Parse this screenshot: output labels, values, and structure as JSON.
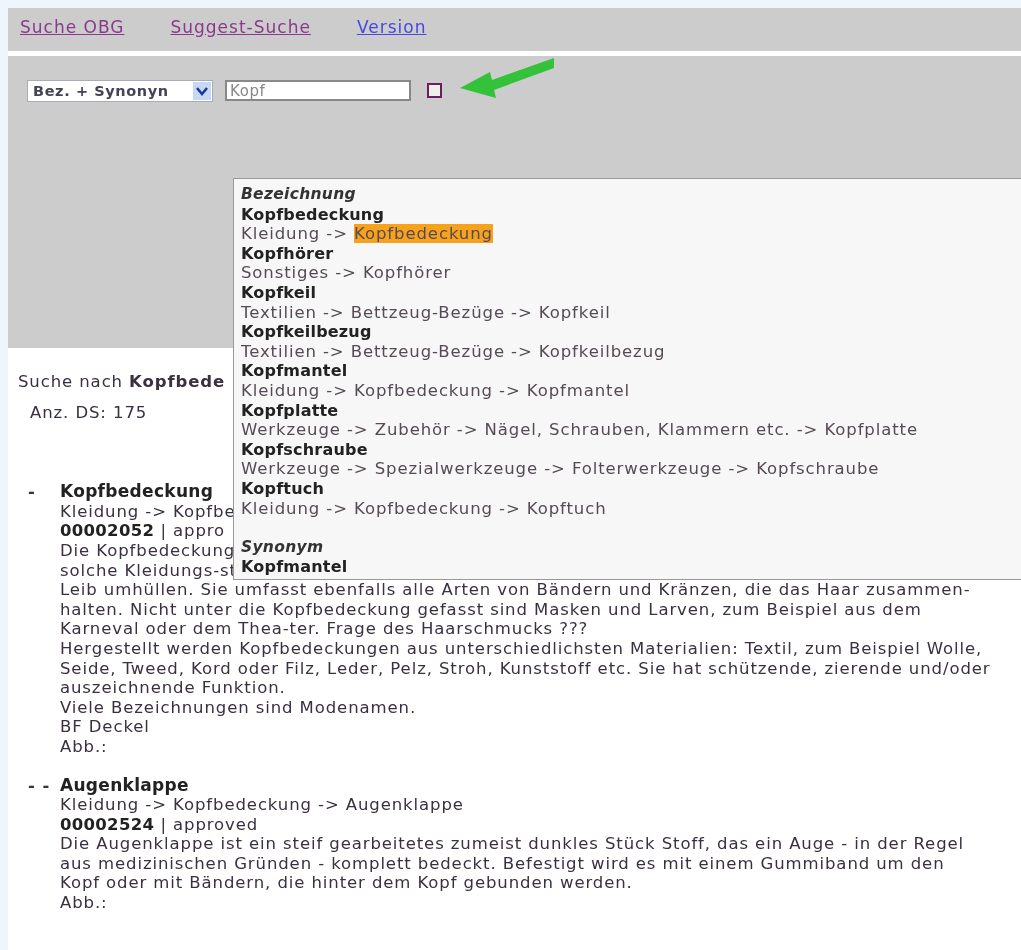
{
  "nav_links": [
    {
      "label": "Suche OBG",
      "visited": true
    },
    {
      "label": "Suggest-Suche",
      "visited": true
    },
    {
      "label": "Version",
      "visited": false
    }
  ],
  "search": {
    "mode": "Bez. + Synonyn",
    "value": "Kopf"
  },
  "suggestions": [
    {
      "heading": "Bezeichnung",
      "items": [
        {
          "name": "Kopfbedeckung",
          "trail": "Kleidung -> ",
          "leaf": "Kopfbedeckung",
          "selected": true
        },
        {
          "name": "Kopfhörer",
          "trail": "Sonstiges -> ",
          "leaf": "Kopfhörer",
          "selected": false
        },
        {
          "name": "Kopfkeil",
          "trail": "Textilien -> Bettzeug-Bezüge -> ",
          "leaf": "Kopfkeil",
          "selected": false
        },
        {
          "name": "Kopfkeilbezug",
          "trail": "Textilien -> Bettzeug-Bezüge -> ",
          "leaf": "Kopfkeilbezug",
          "selected": false
        },
        {
          "name": "Kopfmantel",
          "trail": "Kleidung -> Kopfbedeckung -> ",
          "leaf": "Kopfmantel",
          "selected": false
        },
        {
          "name": "Kopfplatte",
          "trail": "Werkzeuge -> Zubehör -> Nägel, Schrauben, Klammern etc. -> ",
          "leaf": "Kopfplatte",
          "selected": false
        },
        {
          "name": "Kopfschraube",
          "trail": "Werkzeuge -> Spezialwerkzeuge -> Folterwerkzeuge -> ",
          "leaf": "Kopfschraube",
          "selected": false
        },
        {
          "name": "Kopftuch",
          "trail": "Kleidung -> Kopfbedeckung -> ",
          "leaf": "Kopftuch",
          "selected": false
        }
      ]
    },
    {
      "heading": "Synonym",
      "items": [
        {
          "name": "Kopfmantel",
          "selected": false
        }
      ]
    }
  ],
  "result_summary": {
    "query": "Suche nach **Kopfbede**",
    "count": "Anz. DS: 175"
  },
  "results": [
    {
      "marker": "-",
      "title": "Kopfbedeckung",
      "path": "Kleidung -> Kopfbe",
      "id": "00002052",
      "status": "| appro",
      "description": [
        "Die Kopfbedeckung",
        "solche Kleidungs-st",
        "Leib umhüllen. Sie umfasst ebenfalls alle Arten von Bändern und Kränzen, die das Haar zusammen-",
        "halten. Nicht unter die Kopfbedeckung gefasst sind Masken und Larven, zum Beispiel aus dem",
        "Karneval oder dem Thea-ter. Frage des Haarschmucks ???",
        "Hergestellt werden Kopfbedeckungen aus unterschiedlichsten Materialien: Textil, zum Beispiel Wolle,",
        "Seide, Tweed, Kord oder Filz, Leder, Pelz, Stroh, Kunststoff etc. Sie hat schützende, zierende und/oder",
        "auszeichnende Funktion.",
        "Viele Bezeichnungen sind Modenamen.",
        "BF Deckel",
        "Abb.:"
      ]
    },
    {
      "marker": "- -",
      "title": "Augenklappe",
      "path": "Kleidung -> Kopfbedeckung -> Augenklappe",
      "id": "00002524",
      "status": "| approved",
      "description": [
        "Die Augenklappe ist ein steif gearbeitetes zumeist dunkles Stück Stoff, das ein Auge - in der Regel",
        "aus medizinischen Gründen - komplett bedeckt. Befestigt wird es mit einem Gummiband um den",
        "Kopf oder mit Bändern, die hinter dem Kopf gebunden werden.",
        "Abb.:"
      ]
    }
  ]
}
